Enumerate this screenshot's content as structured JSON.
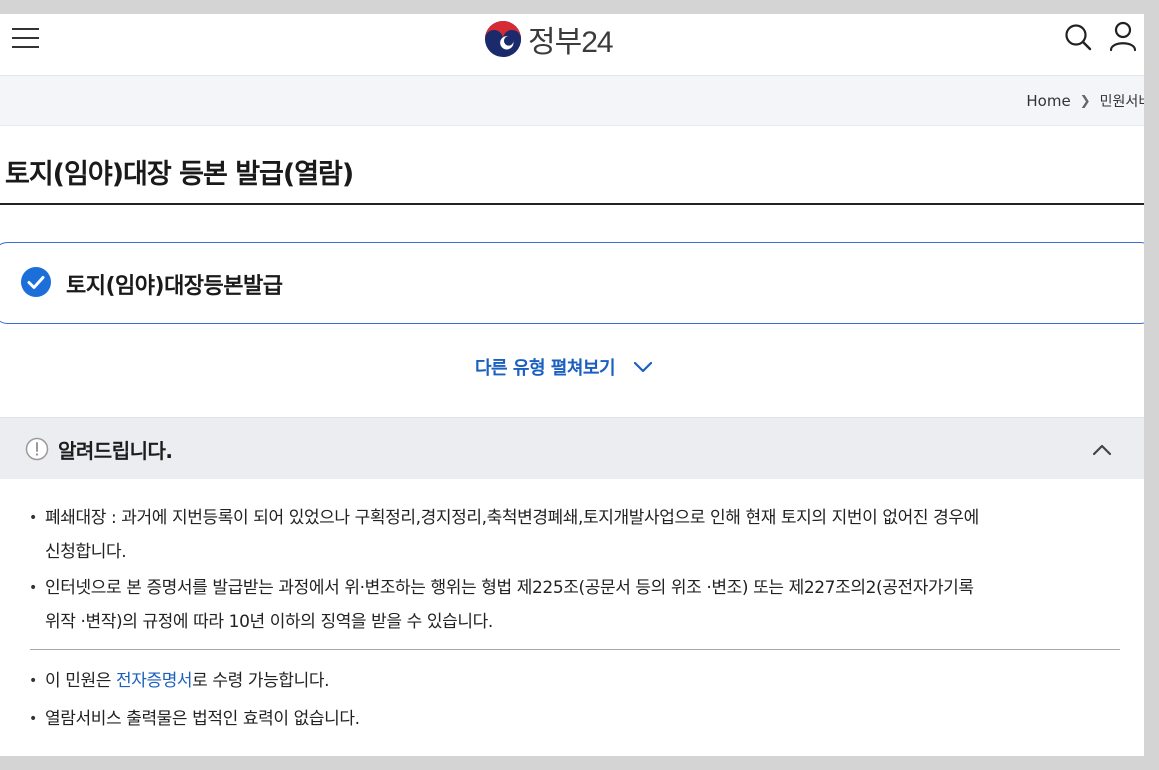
{
  "header": {
    "logo_text": "정부24"
  },
  "breadcrumb": {
    "home": "Home",
    "current": "민원서비스"
  },
  "page": {
    "title": "토지(임야)대장 등본 발급(열람)"
  },
  "option": {
    "label": "토지(임야)대장등본발급"
  },
  "expand": {
    "label": "다른 유형 펼쳐보기"
  },
  "notice": {
    "title": "알려드립니다.",
    "items": [
      {
        "line1": "폐쇄대장 : 과거에 지번등록이 되어 있었으나 구획정리,경지정리,축척변경폐쇄,토지개발사업으로 인해 현재 토지의 지번이 없어진 경우에",
        "line2": "신청합니다."
      },
      {
        "line1": "인터넷으로 본 증명서를 발급받는 과정에서 위·변조하는 행위는 형법 제225조(공문서 등의 위조 ·변조) 또는 제227조의2(공전자가기록",
        "line2": "위작 ·변작)의 규정에 따라 10년 이하의 징역을 받을 수 있습니다."
      }
    ],
    "item3_prefix": "이 민원은 ",
    "item3_link": "전자증명서",
    "item3_suffix": "로 수령 가능합니다.",
    "item4": "열람서비스 출력물은 법적인 효력이 없습니다."
  },
  "colors": {
    "accent": "#1b5fbf",
    "check": "#1c6ed8"
  }
}
